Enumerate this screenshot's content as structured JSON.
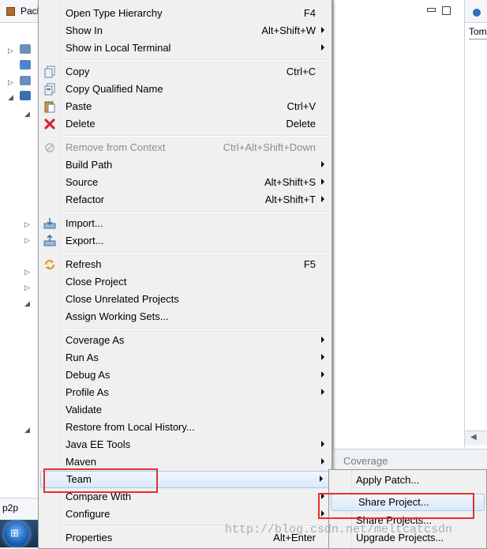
{
  "package_explorer": {
    "tab_title": "Pacl"
  },
  "p2p_tab": {
    "label": "p2p"
  },
  "right_view": {
    "text": "Tom"
  },
  "coverage_tab": {
    "label": "Coverage"
  },
  "context_menu": {
    "items": [
      {
        "label": "Open Type Hierarchy",
        "accel": "F4"
      },
      {
        "label": "Show In",
        "accel": "Alt+Shift+W"
      },
      {
        "label": "Show in Local Terminal",
        "accel": ""
      },
      {
        "label": "Copy",
        "accel": "Ctrl+C"
      },
      {
        "label": "Copy Qualified Name",
        "accel": ""
      },
      {
        "label": "Paste",
        "accel": "Ctrl+V"
      },
      {
        "label": "Delete",
        "accel": "Delete"
      },
      {
        "label": "Remove from Context",
        "accel": "Ctrl+Alt+Shift+Down"
      },
      {
        "label": "Build Path",
        "accel": ""
      },
      {
        "label": "Source",
        "accel": "Alt+Shift+S"
      },
      {
        "label": "Refactor",
        "accel": "Alt+Shift+T"
      },
      {
        "label": "Import...",
        "accel": ""
      },
      {
        "label": "Export...",
        "accel": ""
      },
      {
        "label": "Refresh",
        "accel": "F5"
      },
      {
        "label": "Close Project",
        "accel": ""
      },
      {
        "label": "Close Unrelated Projects",
        "accel": ""
      },
      {
        "label": "Assign Working Sets...",
        "accel": ""
      },
      {
        "label": "Coverage As",
        "accel": ""
      },
      {
        "label": "Run As",
        "accel": ""
      },
      {
        "label": "Debug As",
        "accel": ""
      },
      {
        "label": "Profile As",
        "accel": ""
      },
      {
        "label": "Validate",
        "accel": ""
      },
      {
        "label": "Restore from Local History...",
        "accel": ""
      },
      {
        "label": "Java EE Tools",
        "accel": ""
      },
      {
        "label": "Maven",
        "accel": ""
      },
      {
        "label": "Team",
        "accel": ""
      },
      {
        "label": "Compare With",
        "accel": ""
      },
      {
        "label": "Configure",
        "accel": ""
      },
      {
        "label": "Properties",
        "accel": "Alt+Enter"
      }
    ]
  },
  "team_submenu": {
    "items": [
      {
        "label": "Apply Patch..."
      },
      {
        "label": "Share Project..."
      },
      {
        "label": "Share Projects..."
      },
      {
        "label": "Upgrade Projects..."
      }
    ]
  },
  "watermark": "http://blog.csdn.net/meltcatcsdn",
  "colors": {
    "highlight_border": "#a8caf0",
    "annotation_red": "#e53030"
  },
  "icons": [
    "copy-icon",
    "copy-qualified-icon",
    "paste-icon",
    "delete-icon",
    "remove-context-icon",
    "import-icon",
    "export-icon",
    "refresh-icon"
  ]
}
